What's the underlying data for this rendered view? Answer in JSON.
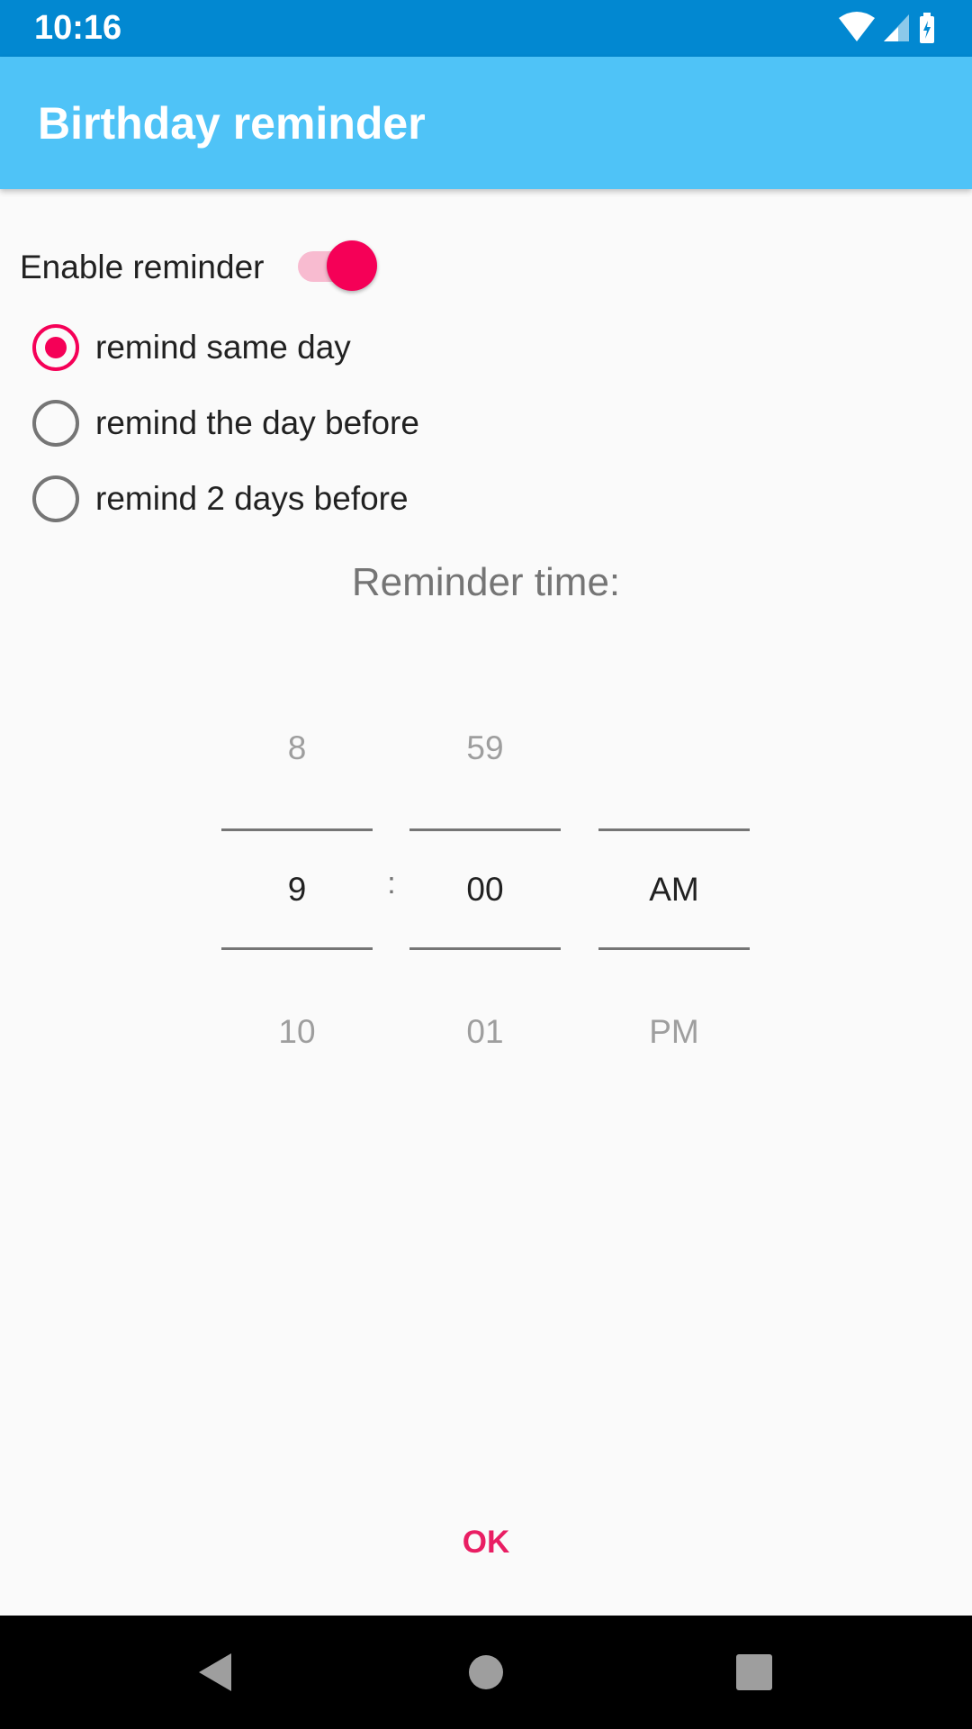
{
  "status_bar": {
    "time": "10:16",
    "icons": [
      "wifi-icon",
      "cell-signal-icon",
      "battery-charging-icon"
    ]
  },
  "app_bar": {
    "title": "Birthday reminder"
  },
  "reminder": {
    "enable_label": "Enable reminder",
    "enabled": true,
    "options": [
      {
        "label": "remind same day",
        "checked": true
      },
      {
        "label": "remind the day before",
        "checked": false
      },
      {
        "label": "remind 2 days before",
        "checked": false
      }
    ]
  },
  "time_picker": {
    "title": "Reminder time:",
    "separator": ":",
    "hour": {
      "prev": "8",
      "selected": "9",
      "next": "10"
    },
    "minute": {
      "prev": "59",
      "selected": "00",
      "next": "01"
    },
    "ampm": {
      "prev": "",
      "selected": "AM",
      "next": "PM"
    }
  },
  "actions": {
    "ok_label": "OK"
  },
  "navigation": {
    "buttons": [
      "back-icon",
      "home-icon",
      "recents-icon"
    ]
  },
  "colors": {
    "status_bar": "#0288d1",
    "app_bar": "#4fc3f7",
    "accent": "#f50057",
    "ok_text": "#e91e63"
  }
}
